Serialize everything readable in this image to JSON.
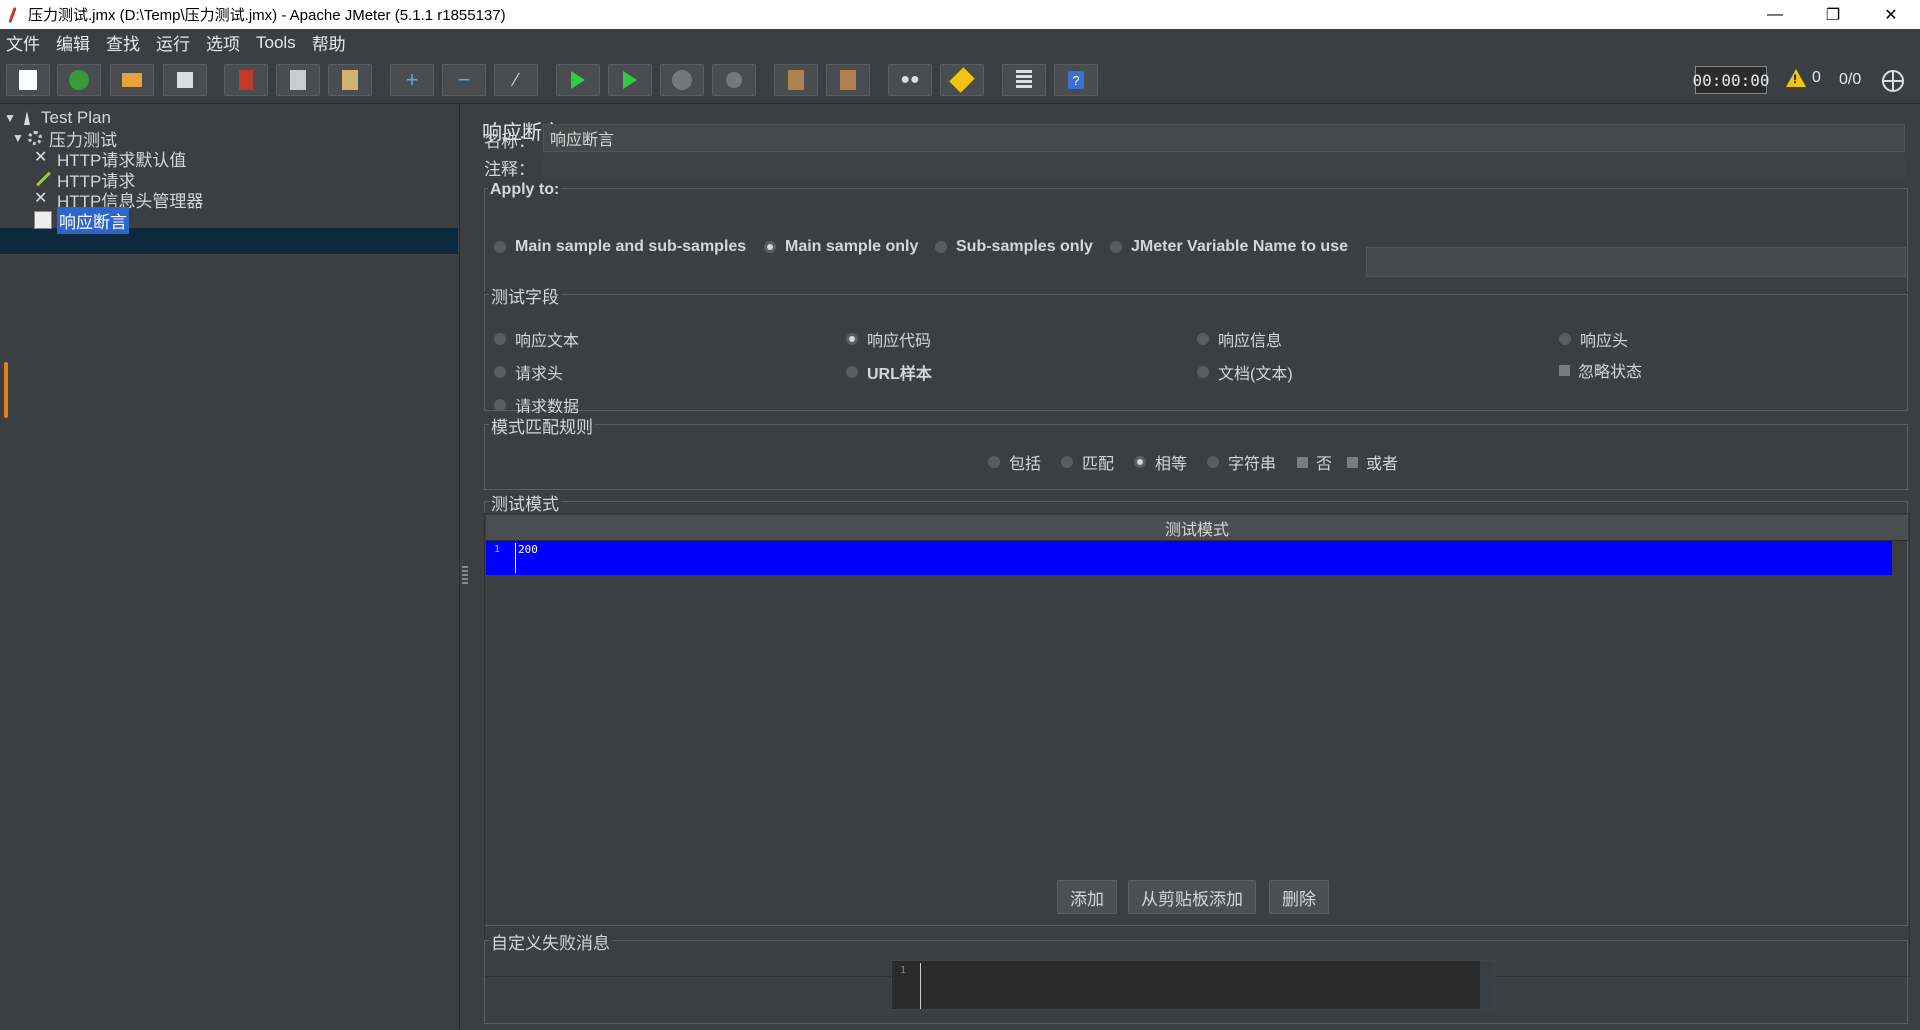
{
  "window": {
    "title": "压力测试.jmx (D:\\Temp\\压力测试.jmx) - Apache JMeter (5.1.1 r1855137)",
    "minimize": "—",
    "maximize": "❐",
    "close": "✕"
  },
  "menu": [
    "文件",
    "编辑",
    "查找",
    "运行",
    "选项",
    "Tools",
    "帮助"
  ],
  "toolbar": {
    "buttons": [
      "new-icon",
      "templates-icon",
      "open-icon",
      "save-icon",
      "cut-icon",
      "copy-icon",
      "paste-icon",
      "expand-icon",
      "collapse-icon",
      "toggle-icon",
      "start-icon",
      "start-no-pause-icon",
      "stop-icon",
      "shutdown-icon",
      "clear-icon",
      "clear-all-icon",
      "search-icon",
      "reset-search-icon",
      "function-helper-icon",
      "help-icon"
    ],
    "timer": "00:00:00",
    "warnings": "0",
    "threads": "0/0"
  },
  "tree": {
    "items": [
      {
        "label": "Test Plan",
        "icon": "test-plan-icon"
      },
      {
        "label": "压力测试",
        "icon": "thread-group-icon"
      },
      {
        "label": "HTTP请求默认值",
        "icon": "config-element-icon"
      },
      {
        "label": "HTTP请求",
        "icon": "sampler-icon"
      },
      {
        "label": "HTTP信息头管理器",
        "icon": "config-element-icon"
      },
      {
        "label": "响应断言",
        "icon": "assertion-icon"
      }
    ],
    "selected": "响应断言"
  },
  "panel": {
    "title": "响应断言",
    "name_label": "名称：",
    "name_value": "响应断言",
    "comment_label": "注释：",
    "comment_value": ""
  },
  "apply_to": {
    "legend": "Apply to:",
    "options": [
      "Main sample and sub-samples",
      "Main sample only",
      "Sub-samples only",
      "JMeter Variable Name to use"
    ],
    "selected": "Main sample only",
    "variable_value": ""
  },
  "test_field": {
    "legend": "测试字段",
    "options": [
      "响应文本",
      "响应代码",
      "响应信息",
      "响应头",
      "请求头",
      "URL样本",
      "文档(文本)",
      "忽略状态",
      "请求数据"
    ],
    "selected": "响应代码",
    "ignore_status": false
  },
  "pattern_rules": {
    "legend": "模式匹配规则",
    "options": [
      "包括",
      "匹配",
      "相等",
      "字符串",
      "否",
      "或者"
    ],
    "selected": "相等"
  },
  "patterns": {
    "legend": "测试模式",
    "column": "测试模式",
    "rows": [
      {
        "line": "1",
        "value": "200"
      }
    ],
    "add": "添加",
    "add_from_clipboard": "从剪贴板添加",
    "delete": "删除"
  },
  "failure_message": {
    "legend": "自定义失败消息",
    "line": "1",
    "value": ""
  },
  "colors": {
    "background": "#3c3f41",
    "selection": "#0000ff",
    "tree_selected": "#2f65ca"
  }
}
